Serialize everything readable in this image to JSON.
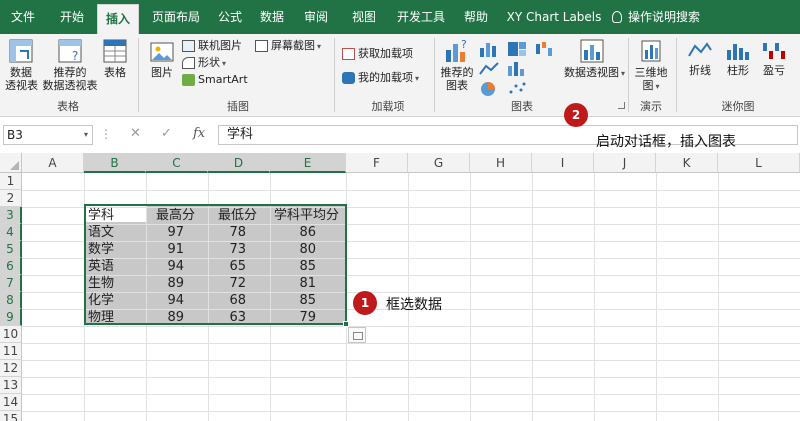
{
  "tabs": [
    "文件",
    "开始",
    "插入",
    "页面布局",
    "公式",
    "数据",
    "审阅",
    "视图",
    "开发工具",
    "帮助",
    "XY Chart Labels",
    "操作说明搜索"
  ],
  "active_tab": "插入",
  "ribbon": {
    "tables": {
      "label": "表格",
      "pivot_table": [
        "数据",
        "透视表"
      ],
      "recommended_pivot": [
        "推荐的",
        "数据透视表"
      ],
      "table": "表格"
    },
    "illustrations": {
      "label": "插图",
      "pictures": "图片",
      "online_pictures": "联机图片",
      "shapes": "形状",
      "smartart": "SmartArt",
      "screenshot": "屏幕截图"
    },
    "addins": {
      "label": "加载项",
      "get_addins": "获取加载项",
      "my_addins": "我的加载项"
    },
    "charts": {
      "label": "图表",
      "recommended_charts": [
        "推荐的",
        "图表"
      ],
      "pivot_chart": "数据透视图"
    },
    "tours": {
      "label": "演示",
      "map_3d": [
        "三维地",
        "图"
      ]
    },
    "sparklines": {
      "label": "迷你图",
      "line": "折线",
      "column": "柱形",
      "win_loss": "盈亏"
    }
  },
  "formula_bar": {
    "name_box": "B3",
    "fx": "fx",
    "content": "学科"
  },
  "sheet": {
    "columns": [
      "A",
      "B",
      "C",
      "D",
      "E",
      "F",
      "G",
      "H",
      "I",
      "J",
      "K",
      "L"
    ],
    "rows": [
      "1",
      "2",
      "3",
      "4",
      "5",
      "6",
      "7",
      "8",
      "9",
      "10",
      "11",
      "12",
      "13",
      "14",
      "15"
    ],
    "headers": [
      "学科",
      "最高分",
      "最低分",
      "学科平均分"
    ],
    "data": [
      [
        "语文",
        "97",
        "78",
        "86"
      ],
      [
        "数学",
        "91",
        "73",
        "80"
      ],
      [
        "英语",
        "94",
        "65",
        "85"
      ],
      [
        "生物",
        "89",
        "72",
        "81"
      ],
      [
        "化学",
        "94",
        "68",
        "85"
      ],
      [
        "物理",
        "89",
        "63",
        "79"
      ]
    ]
  },
  "annotations": [
    {
      "num": "1",
      "text": "框选数据"
    },
    {
      "num": "2",
      "text": "启动对话框，插入图表"
    }
  ],
  "colors": {
    "excel_green": "#217346",
    "badge_red": "#c0191b",
    "selection_gray": "#c8c8c8"
  }
}
